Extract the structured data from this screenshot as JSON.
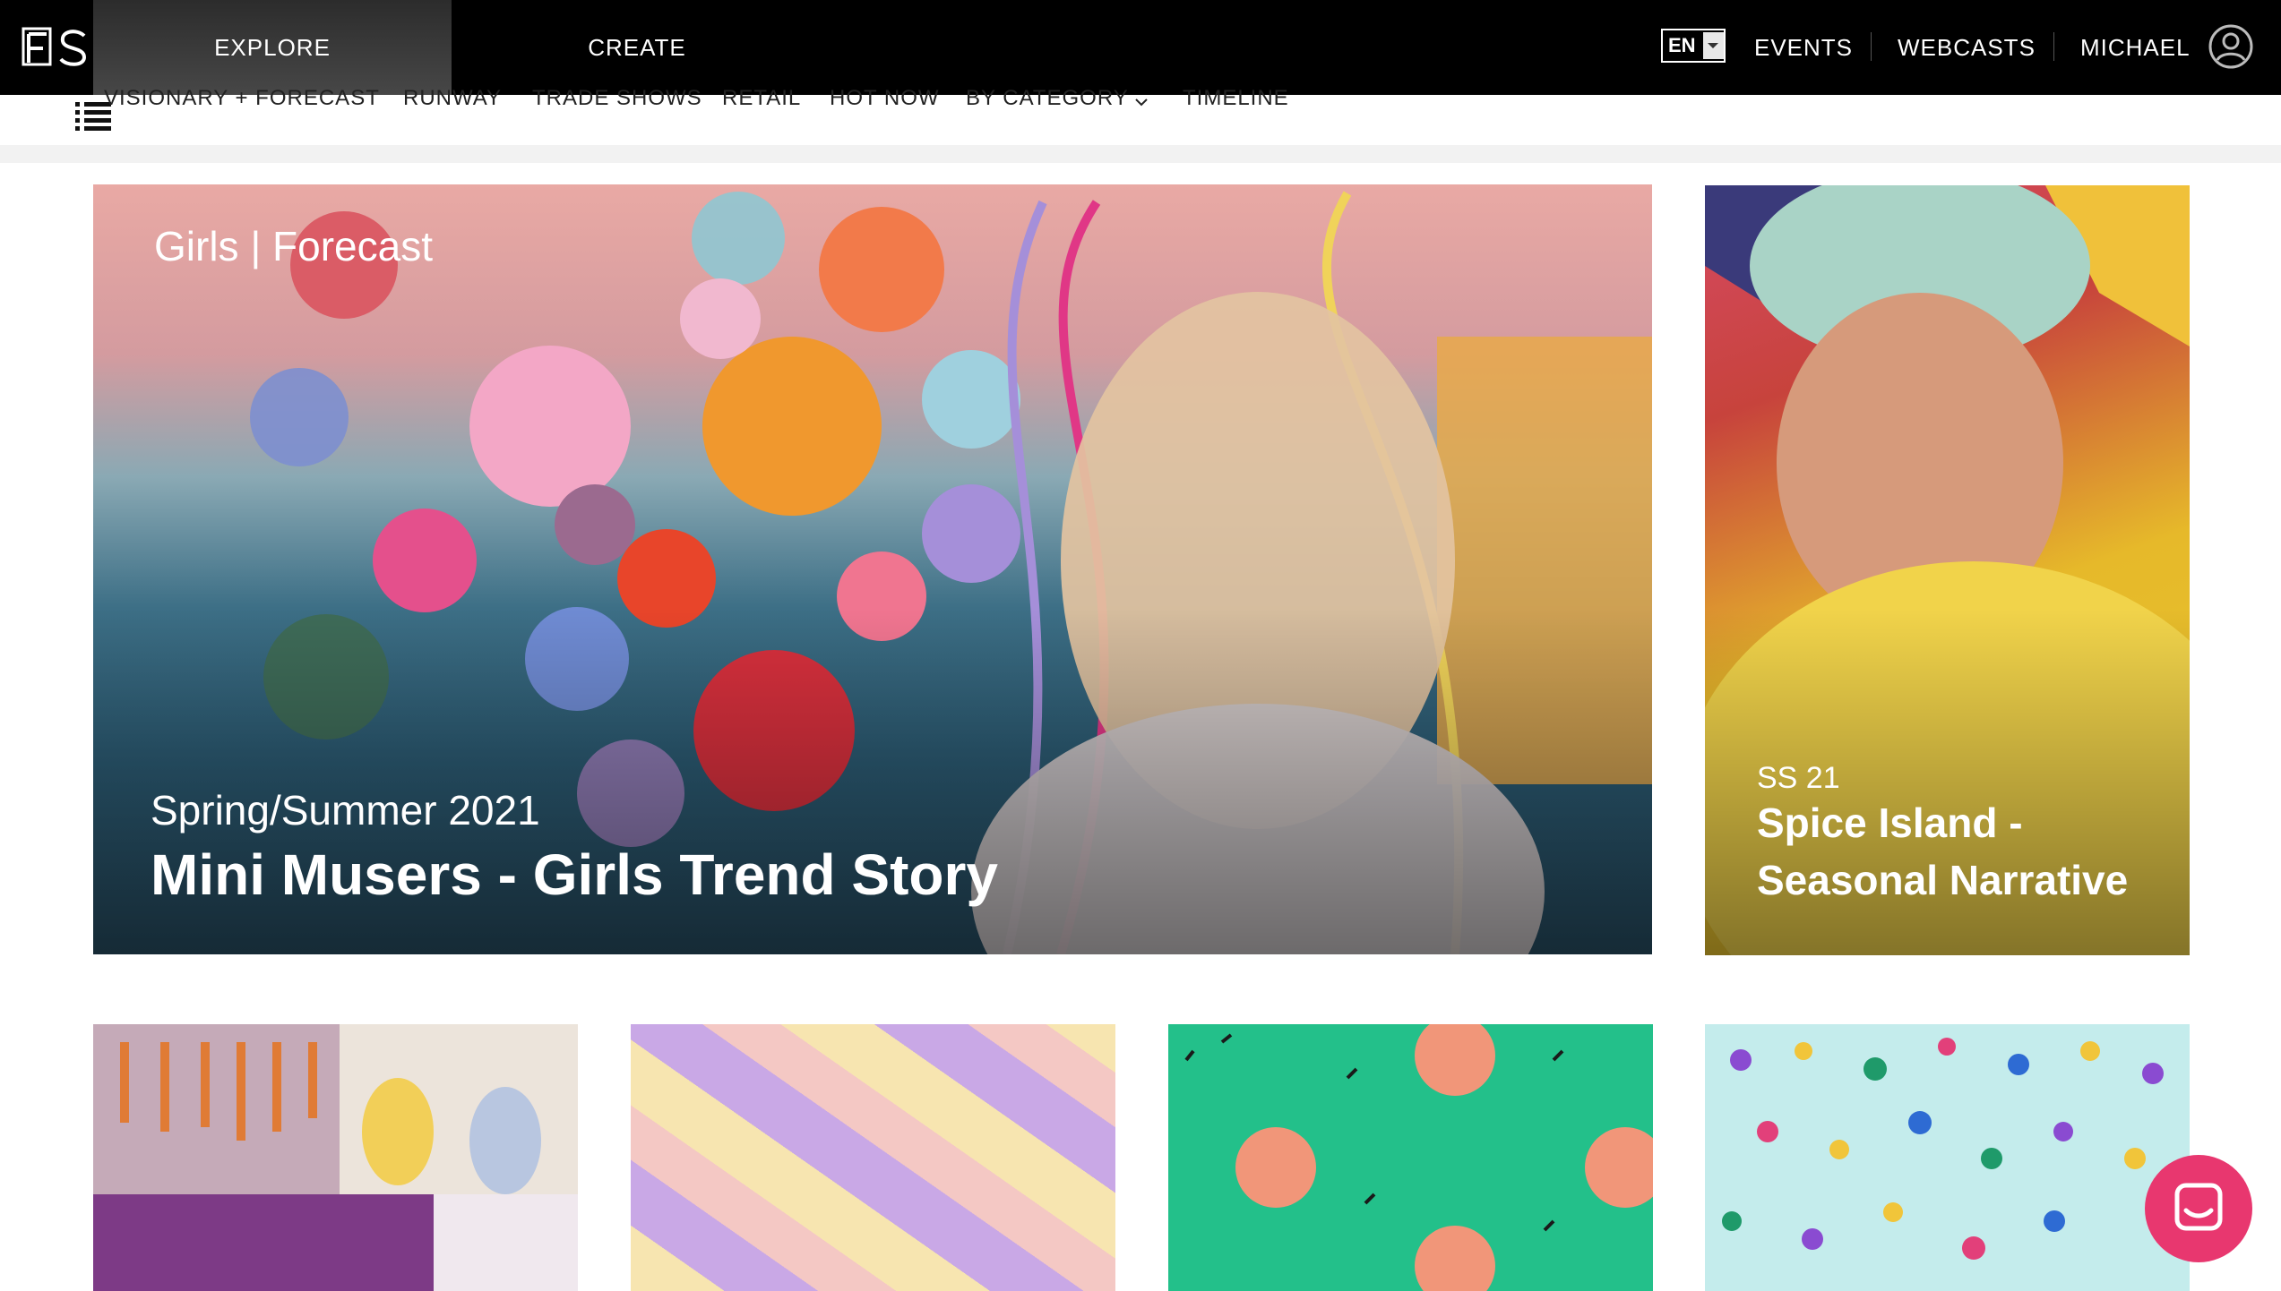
{
  "topbar": {
    "logo_text": "FS",
    "tabs": [
      {
        "label": "EXPLORE",
        "active": true
      },
      {
        "label": "CREATE",
        "active": false
      }
    ],
    "language": "EN",
    "links": [
      "EVENTS",
      "WEBCASTS",
      "MICHAEL"
    ]
  },
  "subnav": {
    "items": [
      "VISIONARY + FORECAST",
      "RUNWAY",
      "TRADE SHOWS",
      "RETAIL",
      "HOT NOW",
      "BY CATEGORY",
      "TIMELINE"
    ]
  },
  "hero": {
    "tag": "Girls | Forecast",
    "season": "Spring/Summer 2021",
    "title": "Mini Musers - Girls Trend Story"
  },
  "side_card": {
    "season": "SS 21",
    "title": "Spice Island - Seasonal Narrative"
  },
  "colors": {
    "topbar": "#000000",
    "chat": "#e8376f"
  },
  "icons": [
    "menu-icon",
    "chevron-down-icon",
    "user-avatar-icon",
    "chat-icon"
  ]
}
